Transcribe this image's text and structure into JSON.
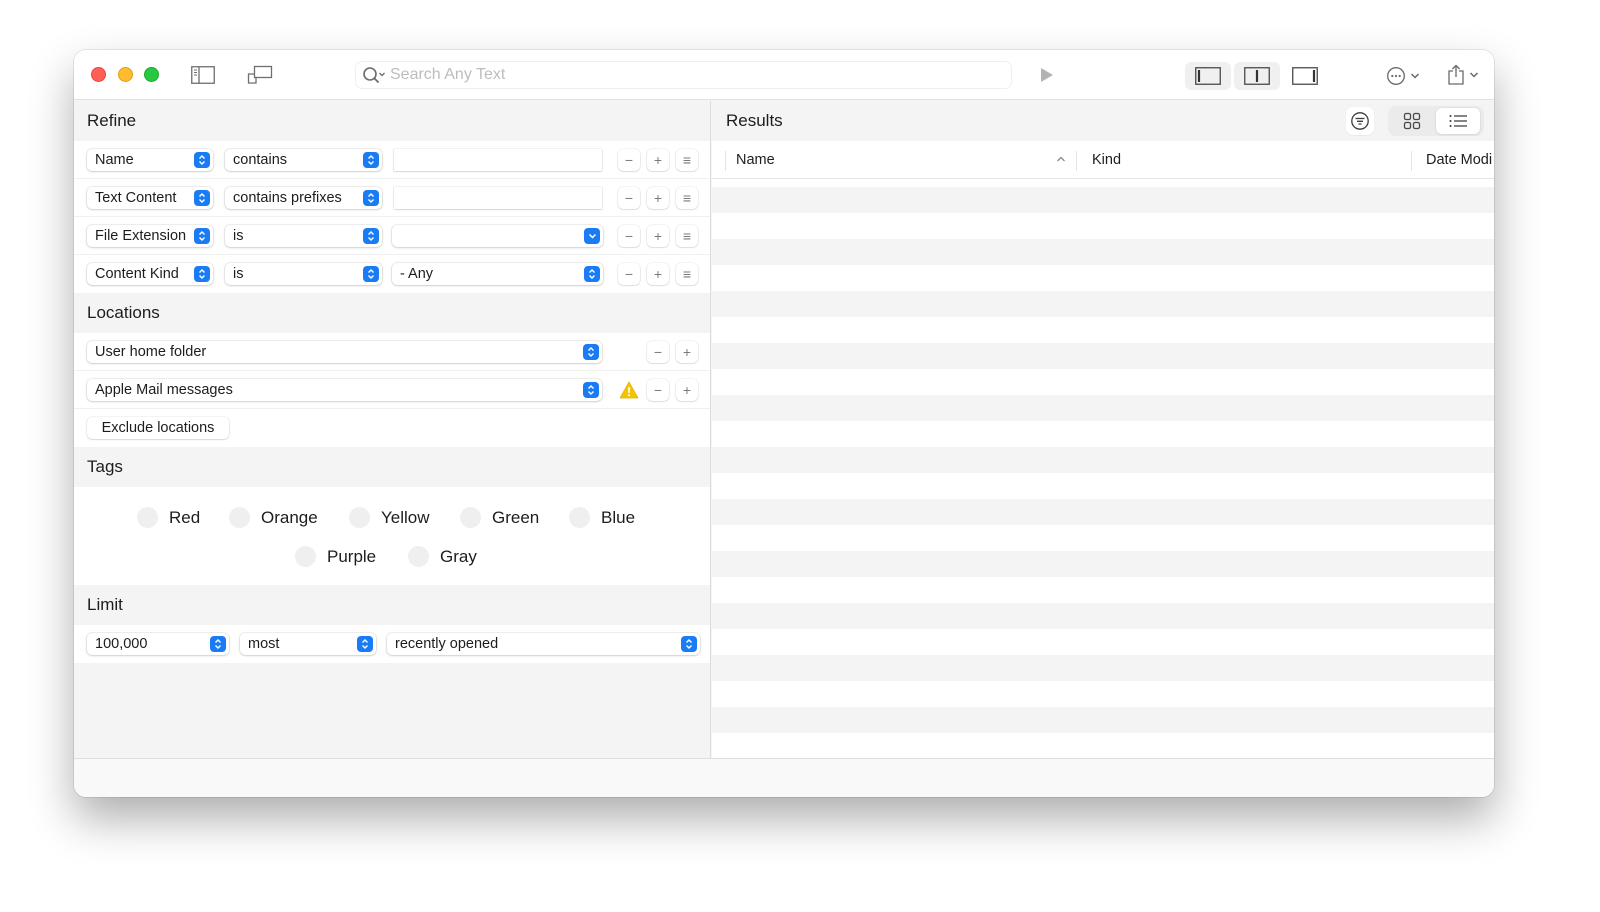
{
  "toolbar": {
    "search_placeholder": "Search Any Text",
    "search_value": "",
    "icons": {
      "sidebar_toggle": "sidebar-icon",
      "windows": "windows-icon",
      "search": "magnifier-dropdown-icon",
      "run": "play-icon",
      "layout_left": "layout-left-icon",
      "layout_split": "layout-split-icon",
      "layout_right": "layout-right-icon",
      "more": "ellipsis-circle-icon",
      "share": "share-icon"
    }
  },
  "refine": {
    "title": "Refine",
    "rows": [
      {
        "attribute": "Name",
        "operator": "contains",
        "value": "",
        "value_type": "text"
      },
      {
        "attribute": "Text Content",
        "operator": "contains prefixes",
        "value": "",
        "value_type": "text"
      },
      {
        "attribute": "File Extension",
        "operator": "is",
        "value": "",
        "value_type": "combo"
      },
      {
        "attribute": "Content Kind",
        "operator": "is",
        "value": "- Any",
        "value_type": "popup"
      }
    ],
    "buttons": {
      "remove": "−",
      "add": "+",
      "more": "≡"
    }
  },
  "locations": {
    "title": "Locations",
    "items": [
      {
        "label": "User home folder",
        "warning": false
      },
      {
        "label": "Apple Mail messages",
        "warning": true
      }
    ],
    "exclude_label": "Exclude locations"
  },
  "tags": {
    "title": "Tags",
    "items": [
      "Red",
      "Orange",
      "Yellow",
      "Green",
      "Blue",
      "Purple",
      "Gray"
    ]
  },
  "limit": {
    "title": "Limit",
    "count": "100,000",
    "order": "most",
    "criterion": "recently opened"
  },
  "results": {
    "title": "Results",
    "columns": [
      "Name",
      "Kind",
      "Date Modi"
    ],
    "sort_column": "Name",
    "sort_direction": "ascending",
    "view_mode": "list",
    "rows": []
  },
  "colors": {
    "accent": "#1a7cf5",
    "close": "#fe5f57",
    "minimize": "#febc2e",
    "maximize": "#28c840",
    "warning": "#f5c400",
    "stripe": "#f4f4f4"
  }
}
